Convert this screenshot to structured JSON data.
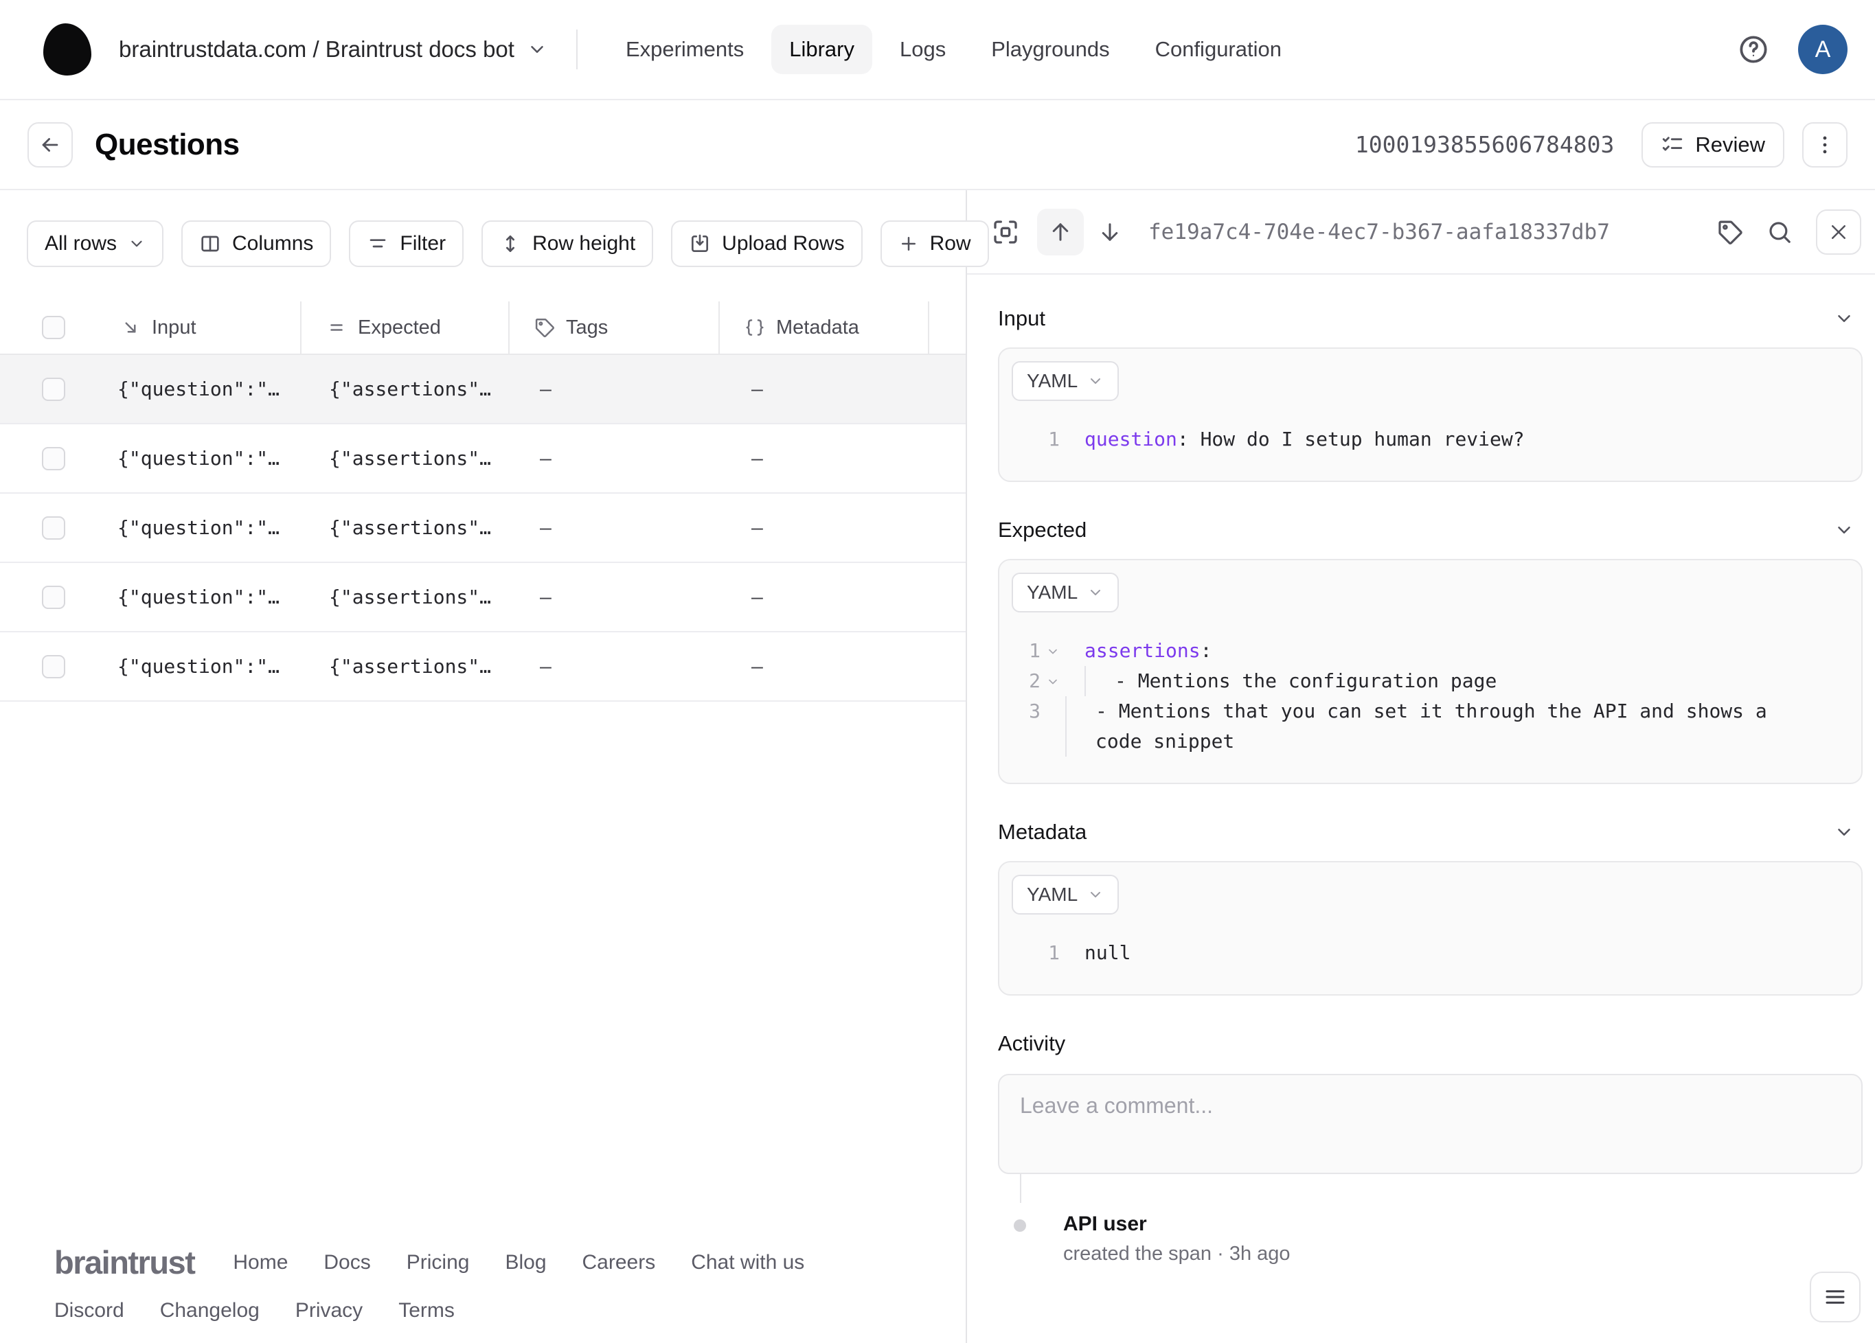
{
  "nav": {
    "breadcrumb": "braintrustdata.com / Braintrust docs bot",
    "items": [
      "Experiments",
      "Library",
      "Logs",
      "Playgrounds",
      "Configuration"
    ],
    "active_item": "Library",
    "avatar_letter": "A"
  },
  "header": {
    "title": "Questions",
    "dataset_id": "1000193855606784803",
    "review_label": "Review"
  },
  "toolbar": {
    "view_filter": "All rows",
    "columns": "Columns",
    "filter": "Filter",
    "row_height": "Row height",
    "upload_rows": "Upload Rows",
    "add_row": "Row"
  },
  "table": {
    "columns": {
      "input": "Input",
      "expected": "Expected",
      "tags": "Tags",
      "metadata": "Metadata"
    },
    "rows": [
      {
        "input": "{\"question\":\"…",
        "expected": "{\"assertions\"…",
        "tags": "–",
        "metadata": "–"
      },
      {
        "input": "{\"question\":\"…",
        "expected": "{\"assertions\"…",
        "tags": "–",
        "metadata": "–"
      },
      {
        "input": "{\"question\":\"…",
        "expected": "{\"assertions\"…",
        "tags": "–",
        "metadata": "–"
      },
      {
        "input": "{\"question\":\"…",
        "expected": "{\"assertions\"…",
        "tags": "–",
        "metadata": "–"
      },
      {
        "input": "{\"question\":\"…",
        "expected": "{\"assertions\"…",
        "tags": "–",
        "metadata": "–"
      }
    ],
    "selected_row_index": 0
  },
  "panel": {
    "span_id": "fe19a7c4-704e-4ec7-b367-aafa18337db7",
    "sections": {
      "input": {
        "title": "Input",
        "format": "YAML",
        "line_num": "1",
        "code_key": "question",
        "code_rest": ": How do I setup human review?"
      },
      "expected": {
        "title": "Expected",
        "format": "YAML",
        "lines": [
          {
            "num": "1",
            "key": "assertions",
            "rest": ":"
          },
          {
            "num": "2",
            "rest": "- Mentions the configuration page"
          },
          {
            "num": "3",
            "rest": "- Mentions that you can set it through the API and shows a code snippet"
          }
        ]
      },
      "metadata": {
        "title": "Metadata",
        "format": "YAML",
        "line_num": "1",
        "code_rest": "null"
      }
    },
    "activity": {
      "title": "Activity",
      "comment_placeholder": "Leave a comment...",
      "events": [
        {
          "actor": "API user",
          "description": "created the span · 3h ago"
        }
      ]
    }
  },
  "footer": {
    "logo": "braintrust",
    "links_row1": [
      "Home",
      "Docs",
      "Pricing",
      "Blog",
      "Careers",
      "Chat with us"
    ],
    "links_row2": [
      "Discord",
      "Changelog",
      "Privacy",
      "Terms"
    ]
  },
  "colors": {
    "avatar": "#2a5d9b",
    "code_key": "#7c3aed",
    "selected_row": "#f4f4f5",
    "border": "#e4e4e7"
  }
}
